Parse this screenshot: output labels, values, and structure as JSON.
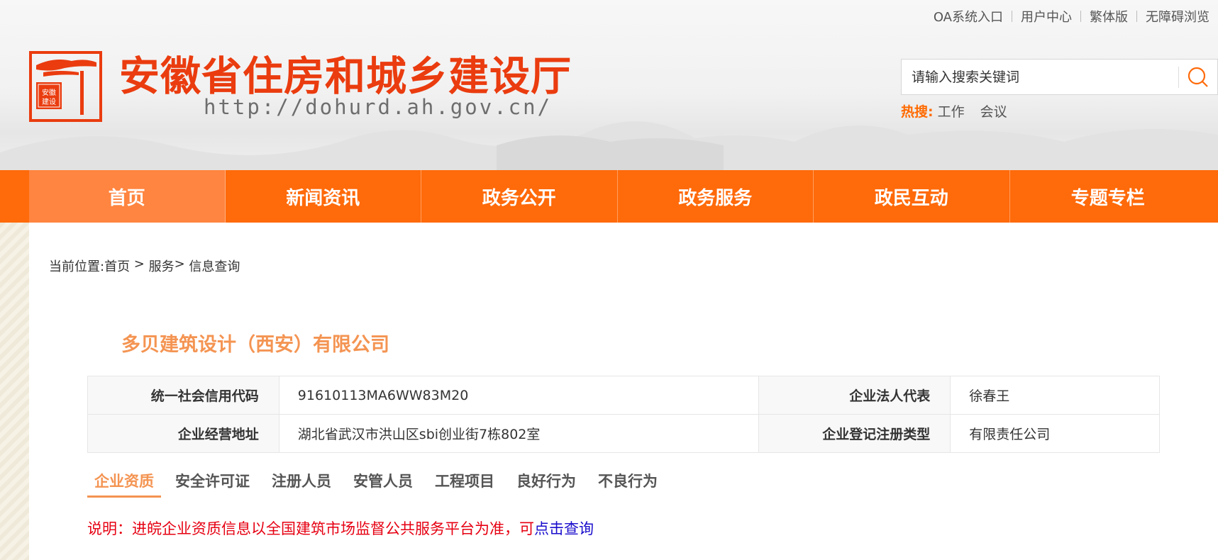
{
  "header": {
    "top_links": [
      "OA系统入口",
      "用户中心",
      "繁体版",
      "无障碍浏览"
    ],
    "title": "安徽省住房和城乡建设厅",
    "url": "http://dohurd.ah.gov.cn/",
    "logo_text": "安徽建设",
    "search": {
      "placeholder": "请输入搜索关键词"
    },
    "hot_label": "热搜:",
    "hot_words": [
      "工作",
      "会议"
    ]
  },
  "nav": [
    "首页",
    "新闻资讯",
    "政务公开",
    "政务服务",
    "政民互动",
    "专题专栏"
  ],
  "breadcrumb": {
    "prefix": "当前位置:",
    "home": "首页",
    "sep1": " > ",
    "service": "服务",
    "sep2": "> ",
    "current": "信息查询"
  },
  "company": {
    "name": "多贝建筑设计（西安）有限公司",
    "rows": [
      {
        "label1": "统一社会信用代码",
        "value1": "91610113MA6WW83M20",
        "label2": "企业法人代表",
        "value2": "徐春王"
      },
      {
        "label1": "企业经营地址",
        "value1": "湖北省武汉市洪山区sbi创业街7栋802室",
        "label2": "企业登记注册类型",
        "value2": "有限责任公司"
      }
    ]
  },
  "tabs": [
    "企业资质",
    "安全许可证",
    "注册人员",
    "安管人员",
    "工程项目",
    "良好行为",
    "不良行为"
  ],
  "note": {
    "text": "说明：进皖企业资质信息以全国建筑市场监督公共服务平台为准，可",
    "link": "点击查询"
  },
  "colors": {
    "brand_orange": "#ff6a0a",
    "title_red": "#ea3c0f",
    "company_orange": "#f49452",
    "note_red": "#e60012",
    "link_blue": "#1a0dcc"
  }
}
